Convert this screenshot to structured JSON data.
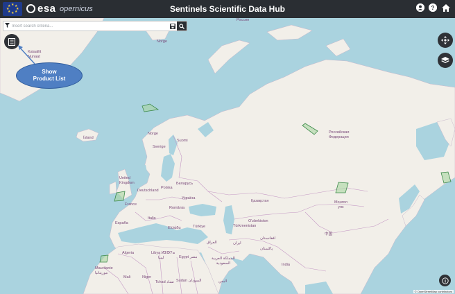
{
  "app": {
    "title": "Sentinels Scientific Data Hub",
    "esa_logo": "esa",
    "copernicus_logo": "opernicus"
  },
  "header_icons": [
    "user-icon",
    "help-icon",
    "home-icon"
  ],
  "search": {
    "placeholder": "Insert search criteria...",
    "value": ""
  },
  "callout": {
    "line1": "Show",
    "line2": "Product List"
  },
  "map": {
    "labels": {
      "greenland": [
        "Kalaallit",
        "Nunaat"
      ],
      "norge_top": "Norge",
      "russia_top": "Россия",
      "island": "Ísland",
      "norge": "Norge",
      "sverige": "Sverige",
      "suomi": "Suomi",
      "russia": [
        "Российская",
        "Федерация"
      ],
      "uk": [
        "United",
        "Kingdom"
      ],
      "deutschland": "Deutschland",
      "polska": "Polska",
      "belarus": "Беларусь",
      "ukraina": "Україна",
      "france": "France",
      "romania": "România",
      "kazakhstan": "Қазақстан",
      "mongolia": [
        "Монгол",
        "улс"
      ],
      "espana": "España",
      "italia": "Italia",
      "ellada": "Ελλάδα",
      "turkiye": "Türkiye",
      "uzbekistan": "O'zbekiston",
      "turkmenistan": "Türkmenistan",
      "china": "中国",
      "iraq": "العراق",
      "iran": "ایران",
      "afghanistan": "افغانستان",
      "pakistan": "پاکستان",
      "algeria": "Algeria",
      "libya": [
        "Libya ⵍⵉⴱⵢⴰ",
        "ليبيا"
      ],
      "egypt": "Egypt مصر",
      "saudi": [
        "المملكة العربية",
        "السعودية"
      ],
      "india": "India",
      "mauritanie": [
        "Mauritanie",
        "موريتانيا"
      ],
      "mali": "Mali",
      "niger": "Niger",
      "tchad": "Tchad تشاد",
      "sudan": "Sudan السودان",
      "yemen": "اليمن"
    }
  },
  "attribution": "© OpenStreetMap contributors",
  "colors": {
    "header": "#2a2e33",
    "water": "#aad3df",
    "land": "#f2efe9",
    "footprint_fill": "#a9d6a2",
    "footprint_stroke": "#3d8a4a",
    "callout": "#4f7fc3"
  }
}
